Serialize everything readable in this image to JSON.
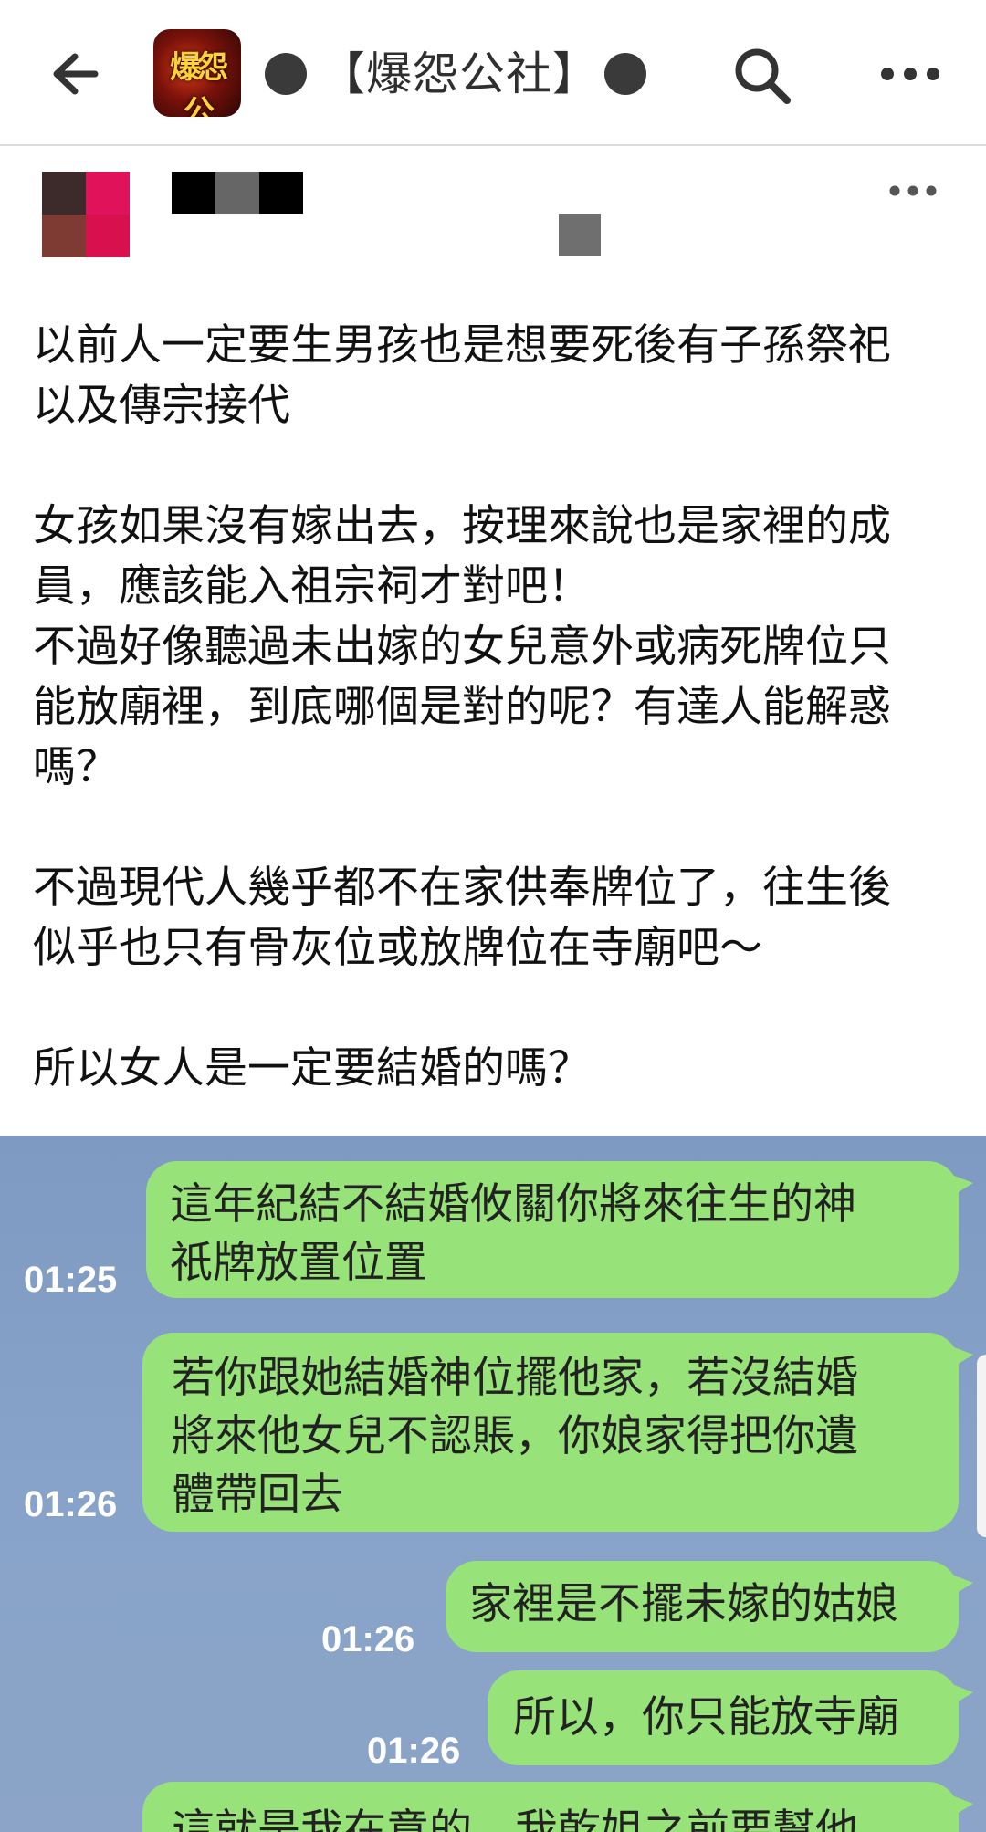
{
  "header": {
    "group_title": "【爆怨公社】",
    "group_avatar_text": "爆怨公",
    "icons": {
      "back": "back-arrow-icon",
      "search": "search-icon",
      "more": "more-horizontal-icon"
    }
  },
  "post": {
    "paragraphs": [
      [
        "以前人一定要生男孩也是想要死後有子孫祭祀",
        "以及傳宗接代"
      ],
      [
        "女孩如果沒有嫁出去，按理來說也是家裡的成",
        "員，應該能入祖宗祠才對吧！",
        "不過好像聽過未出嫁的女兒意外或病死牌位只",
        "能放廟裡，到底哪個是對的呢？有達人能解惑",
        "嗎？"
      ],
      [
        "不過現代人幾乎都不在家供奉牌位了，往生後",
        "似乎也只有骨灰位或放牌位在寺廟吧～"
      ],
      [
        "所以女人是一定要結婚的嗎？"
      ]
    ]
  },
  "chat": {
    "messages": [
      {
        "time": "01:25",
        "lines": [
          "這年紀結不結婚攸關你將來往生的神",
          "祇牌放置位置"
        ]
      },
      {
        "time": "01:26",
        "lines": [
          "若你跟她結婚神位擺他家，若沒結婚",
          "將來他女兒不認賬，你娘家得把你遺",
          "體帶回去"
        ]
      },
      {
        "time": "01:26",
        "lines": [
          "家裡是不擺未嫁的姑娘"
        ]
      },
      {
        "time": "01:26",
        "lines": [
          "所以，你只能放寺廟"
        ]
      },
      {
        "time": "",
        "lines": [
          "這就是我在意的，我乾姐之前要幫他"
        ]
      }
    ]
  },
  "colors": {
    "chat_background": "#86a1c7",
    "bubble": "#98e27a",
    "timestamp": "#ffffff",
    "text": "#111111"
  }
}
